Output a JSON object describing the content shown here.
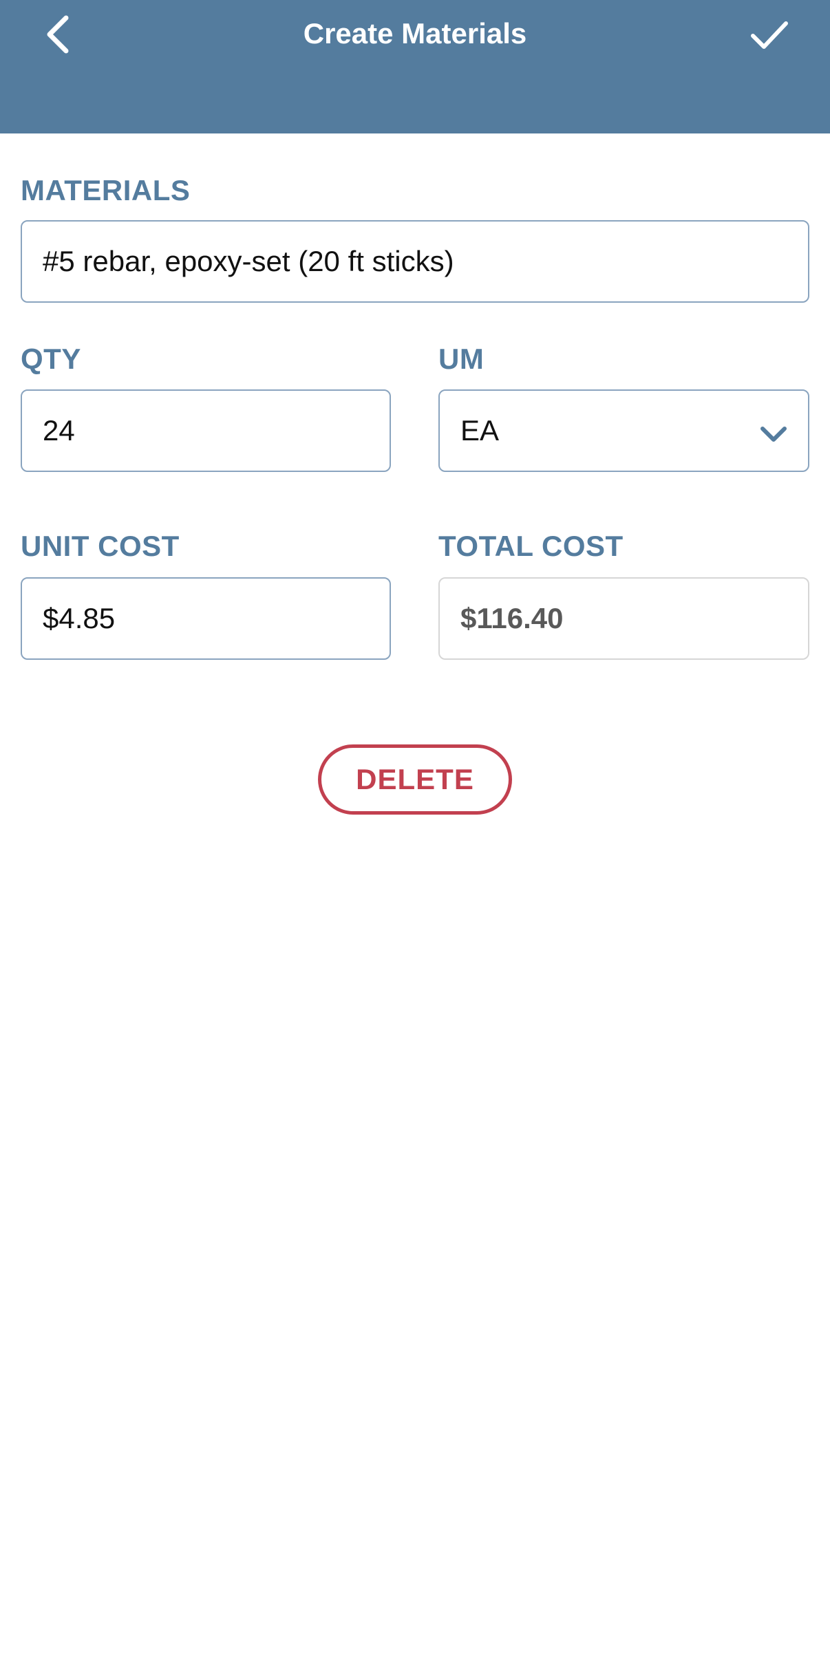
{
  "header": {
    "title": "Create Materials",
    "back_icon": "chevron-left-icon",
    "confirm_icon": "checkmark-icon",
    "background_color": "#547c9e"
  },
  "form": {
    "materials": {
      "label": "MATERIALS",
      "value": "#5 rebar, epoxy-set (20 ft sticks)"
    },
    "qty": {
      "label": "QTY",
      "value": "24"
    },
    "um": {
      "label": "UM",
      "value": "EA",
      "icon": "chevron-down-icon"
    },
    "unit_cost": {
      "label": "UNIT COST",
      "value": "$4.85"
    },
    "total_cost": {
      "label": "TOTAL COST",
      "value": "$116.40"
    }
  },
  "actions": {
    "delete_label": "DELETE",
    "delete_color": "#c2404f"
  }
}
